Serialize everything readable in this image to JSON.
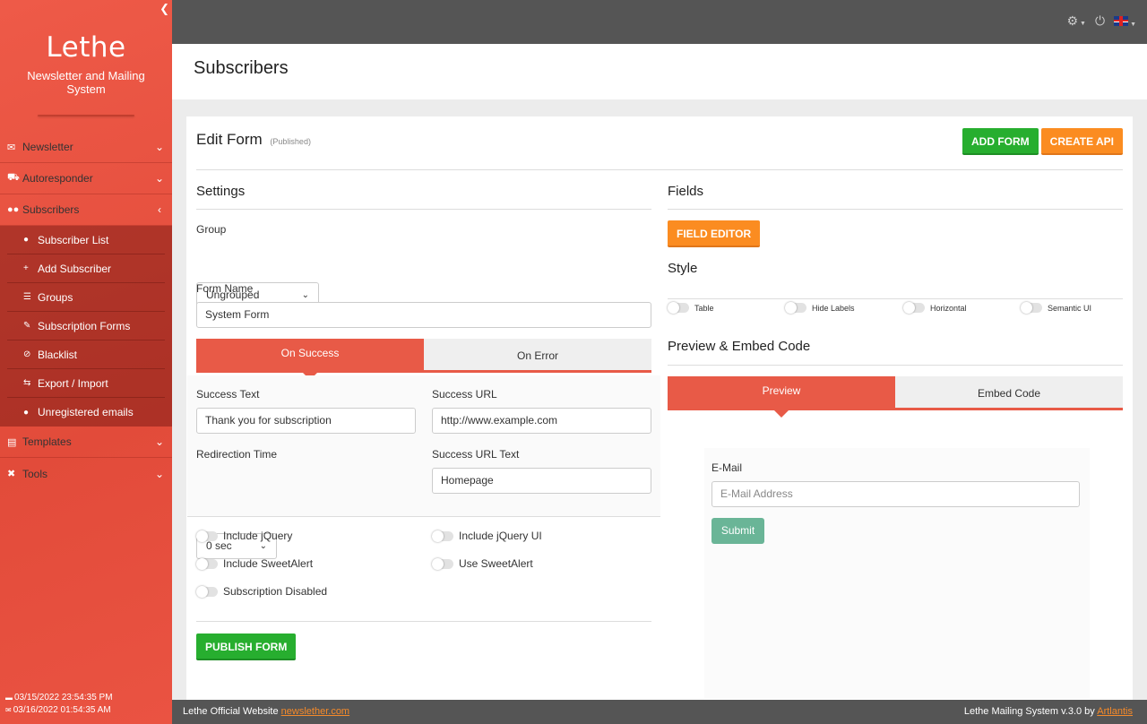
{
  "sidebar": {
    "brand_title": "Lethe",
    "brand_subtitle": "Newsletter and Mailing System",
    "items": [
      {
        "label": "Newsletter",
        "icon": "envelope-icon"
      },
      {
        "label": "Autoresponder",
        "icon": "truck-icon"
      },
      {
        "label": "Subscribers",
        "icon": "users-icon"
      },
      {
        "label": "Templates",
        "icon": "template-icon"
      },
      {
        "label": "Tools",
        "icon": "tools-icon"
      }
    ],
    "subitems": [
      {
        "label": "Subscriber List",
        "icon": "users-icon"
      },
      {
        "label": "Add Subscriber",
        "icon": "plus-icon"
      },
      {
        "label": "Groups",
        "icon": "list-icon"
      },
      {
        "label": "Subscription Forms",
        "icon": "edit-icon"
      },
      {
        "label": "Blacklist",
        "icon": "ban-icon"
      },
      {
        "label": "Export / Import",
        "icon": "exchange-icon"
      },
      {
        "label": "Unregistered emails",
        "icon": "user-slash-icon"
      }
    ],
    "timestamps": [
      "03/15/2022 23:54:35 PM",
      "03/16/2022 01:54:35 AM"
    ]
  },
  "page": {
    "title": "Subscribers"
  },
  "form": {
    "title": "Edit Form",
    "status": "(Published)",
    "add_form": "ADD FORM",
    "create_api": "CREATE API",
    "settings_title": "Settings",
    "group_label": "Group",
    "group_value": "Ungrouped",
    "form_name_label": "Form Name",
    "form_name_value": "System Form",
    "tab_success": "On Success",
    "tab_error": "On Error",
    "success_text_label": "Success Text",
    "success_text_value": "Thank you for subscription",
    "success_url_label": "Success URL",
    "success_url_value": "http://www.example.com",
    "redirection_label": "Redirection Time",
    "redirection_value": "0 sec",
    "success_url_text_label": "Success URL Text",
    "success_url_text_value": "Homepage",
    "opt_jquery": "Include jQuery",
    "opt_jquery_ui": "Include jQuery UI",
    "opt_sweetalert": "Include SweetAlert",
    "opt_use_sweetalert": "Use SweetAlert",
    "opt_disabled": "Subscription Disabled",
    "publish": "PUBLISH FORM"
  },
  "fields": {
    "title": "Fields",
    "editor_button": "FIELD EDITOR",
    "style_title": "Style",
    "style_table": "Table",
    "style_hide_labels": "Hide Labels",
    "style_horizontal": "Horizontal",
    "style_semantic": "Semantic UI",
    "preview_title": "Preview & Embed Code",
    "tab_preview": "Preview",
    "tab_embed": "Embed Code",
    "email_label": "E-Mail",
    "email_placeholder": "E-Mail Address",
    "submit": "Submit"
  },
  "footer": {
    "left_text": "Lethe Official Website",
    "left_link": "newslether.com",
    "right_text": "Lethe Mailing System v.3.0 by",
    "right_link": "Artlantis"
  },
  "colors": {
    "sidebar": "#e85a47",
    "green": "#27ae2f",
    "orange": "#fb8c21",
    "submit": "#6ab597"
  }
}
